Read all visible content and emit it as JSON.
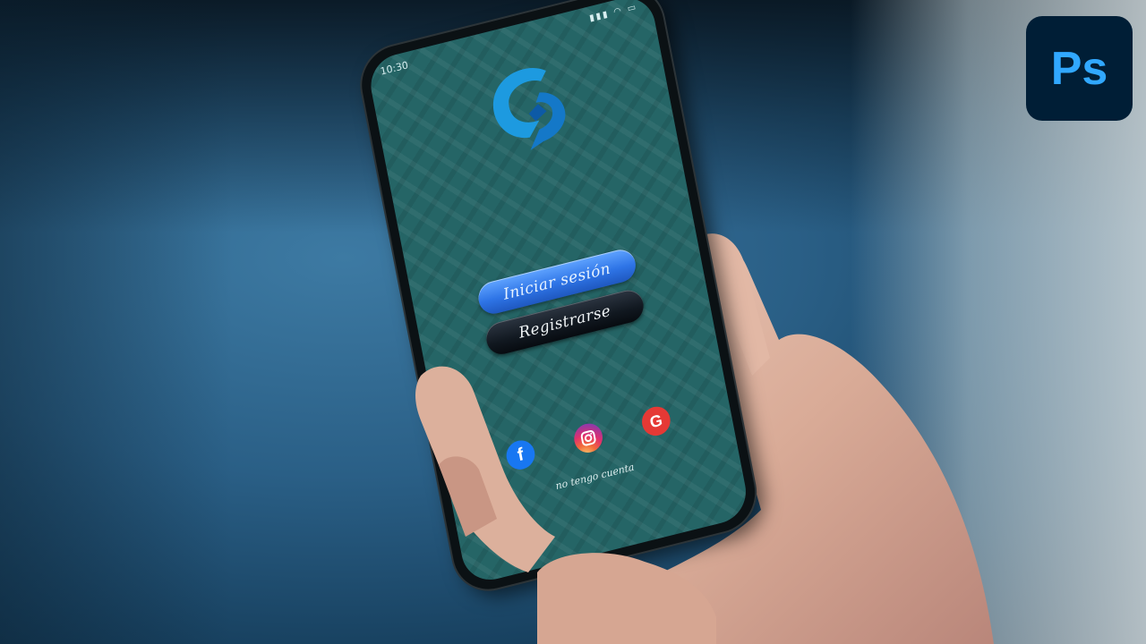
{
  "status_bar": {
    "time": "10:30"
  },
  "app": {
    "login_label": "Iniciar sesión",
    "register_label": "Registrarse",
    "no_account_label": "no tengo cuenta",
    "social": [
      {
        "name": "facebook",
        "glyph": "f"
      },
      {
        "name": "instagram",
        "glyph": "◎"
      },
      {
        "name": "google",
        "glyph": "G"
      }
    ]
  },
  "badge": {
    "text": "Ps"
  },
  "colors": {
    "screen_bg": "#256566",
    "login_button": "#2e74e6",
    "register_button": "#111820",
    "photoshop_blue": "#31a8ff"
  }
}
